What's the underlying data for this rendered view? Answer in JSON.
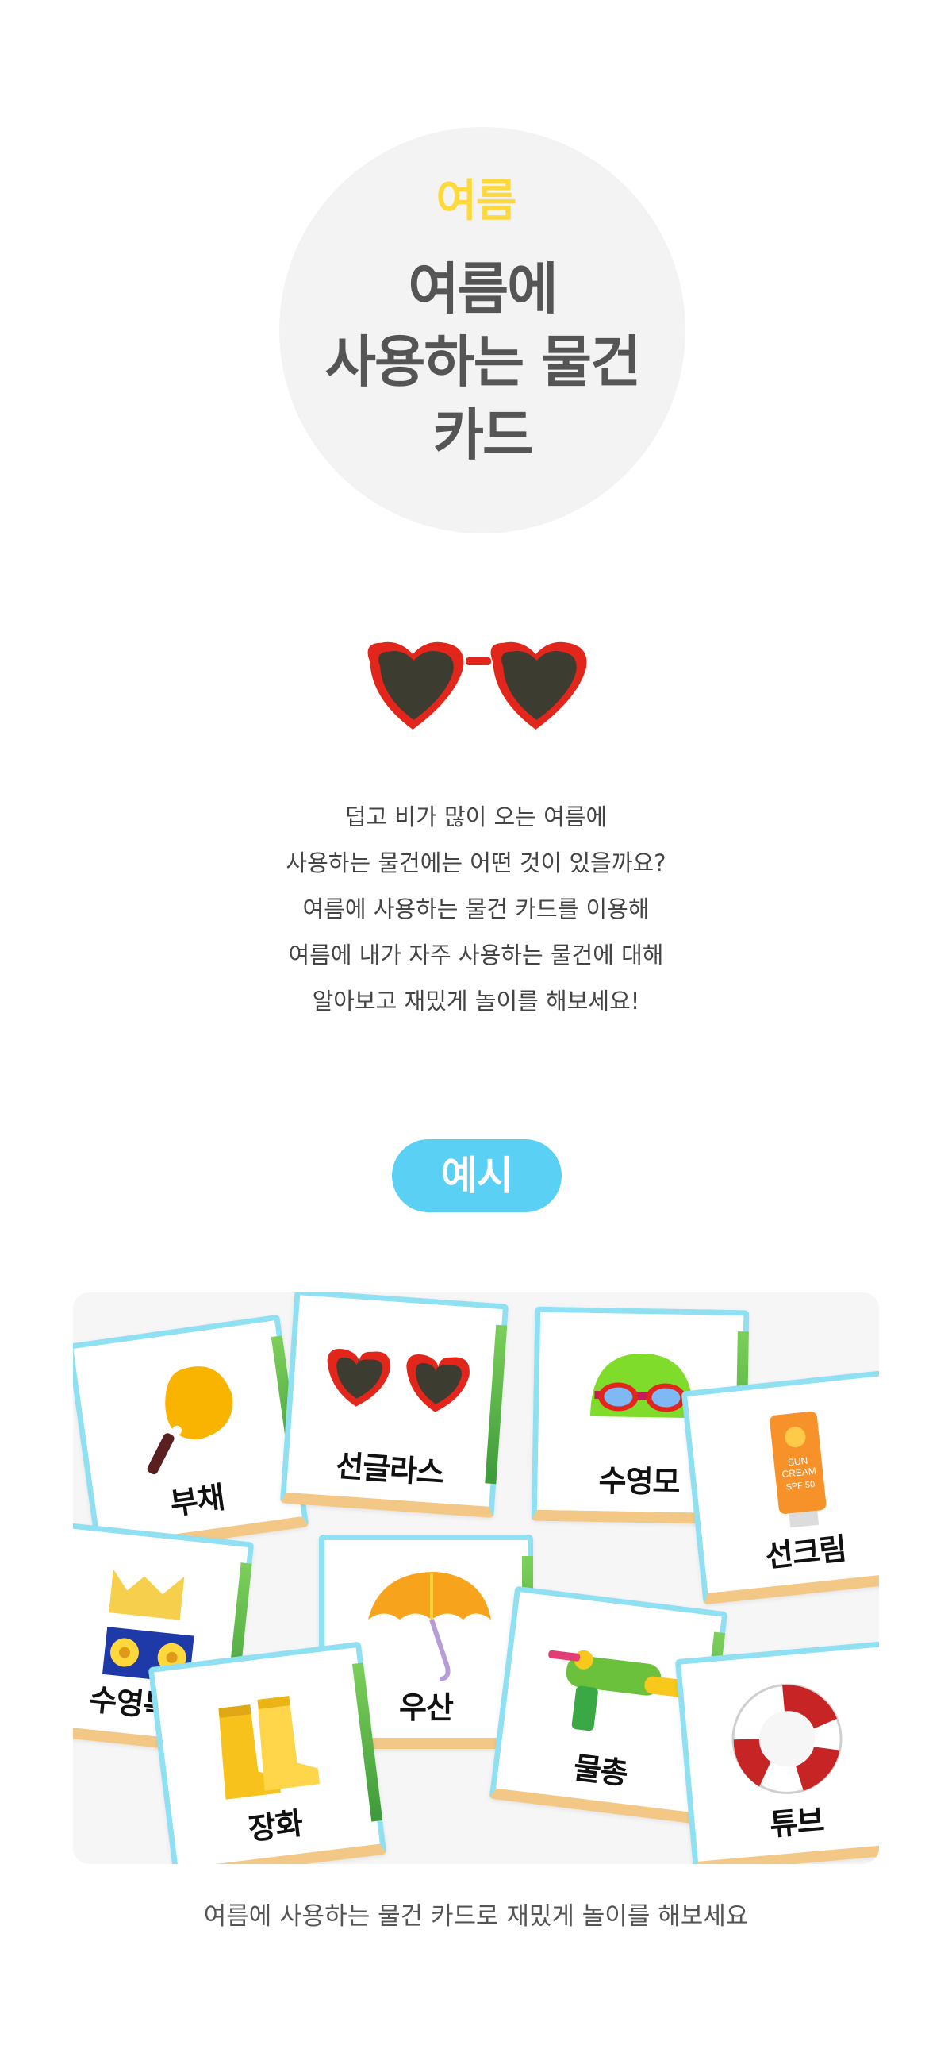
{
  "hero": {
    "category": "여름",
    "title_lines": [
      "여름에",
      "사용하는 물건",
      "카드"
    ]
  },
  "hero_icon": "heart-sunglasses-icon",
  "intro_lines": [
    "덥고 비가 많이 오는 여름에",
    "사용하는 물건에는 어떤 것이 있을까요?",
    "여름에 사용하는 물건 카드를 이용해",
    "여름에 내가 자주 사용하는 물건에 대해",
    "알아보고 재밌게 놀이를 해보세요!"
  ],
  "example_label": "예시",
  "cards": [
    {
      "label": "부채",
      "icon": "hand-fan-icon"
    },
    {
      "label": "선글라스",
      "icon": "sunglasses-icon"
    },
    {
      "label": "수영모",
      "icon": "swim-cap-icon"
    },
    {
      "label": "선크림",
      "icon": "sunscreen-icon",
      "art_text": [
        "SUN",
        "CREAM",
        "SPF 50"
      ]
    },
    {
      "label": "수영복",
      "icon": "swimsuit-icon"
    },
    {
      "label": "우산",
      "icon": "umbrella-icon"
    },
    {
      "label": "물총",
      "icon": "water-gun-icon"
    },
    {
      "label": "장화",
      "icon": "rain-boots-icon"
    },
    {
      "label": "튜브",
      "icon": "swim-ring-icon"
    }
  ],
  "caption": "여름에 사용하는 물건 카드로 재밌게 놀이를 해보세요",
  "colors": {
    "accent_yellow": "#ffd93b",
    "pill_blue": "#5ad0f5",
    "title_gray": "#555555",
    "circle_bg": "#f3f3f3"
  }
}
